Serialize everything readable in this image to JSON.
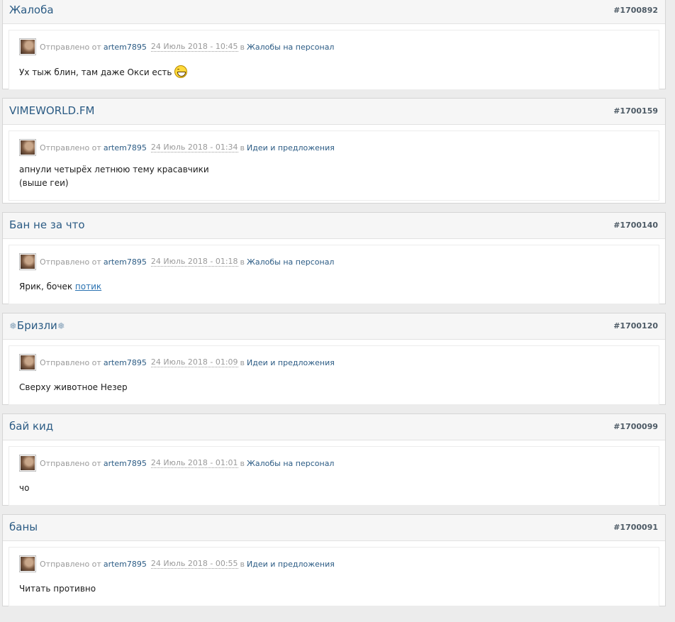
{
  "sent_prefix": "Отправлено от",
  "in_word": "в",
  "posts": [
    {
      "title": "Жалоба",
      "id": "#1700892",
      "author": "artem7895",
      "date": "24 Июль 2018 - 10:45",
      "forum": "Жалобы на персонал",
      "text": "Ух тыж блин, там даже Окси есть",
      "smiley": "big-grin-smiley"
    },
    {
      "title": "VIMEWORLD.FM",
      "id": "#1700159",
      "author": "artem7895",
      "date": "24 Июль 2018 - 01:34",
      "forum": "Идеи и предложения",
      "lines": [
        "апнули четырёх летнюю тему красавчики",
        "(выше геи)"
      ]
    },
    {
      "title": "Бан не за что",
      "id": "#1700140",
      "author": "artem7895",
      "date": "24 Июль 2018 - 01:18",
      "forum": "Жалобы на персонал",
      "text": "Ярик, бочек",
      "link": "потик"
    },
    {
      "title_flake_left": "❅",
      "title": "Бризли",
      "title_flake_right": "❅",
      "id": "#1700120",
      "author": "artem7895",
      "date": "24 Июль 2018 - 01:09",
      "forum": "Идеи и предложения",
      "text": "Сверху животное Незер"
    },
    {
      "title": "бай кид",
      "id": "#1700099",
      "author": "artem7895",
      "date": "24 Июль 2018 - 01:01",
      "forum": "Жалобы на персонал",
      "text": "чо"
    },
    {
      "title": "баны",
      "id": "#1700091",
      "author": "artem7895",
      "date": "24 Июль 2018 - 00:55",
      "forum": "Идеи и предложения",
      "text": "Читать противно"
    }
  ]
}
